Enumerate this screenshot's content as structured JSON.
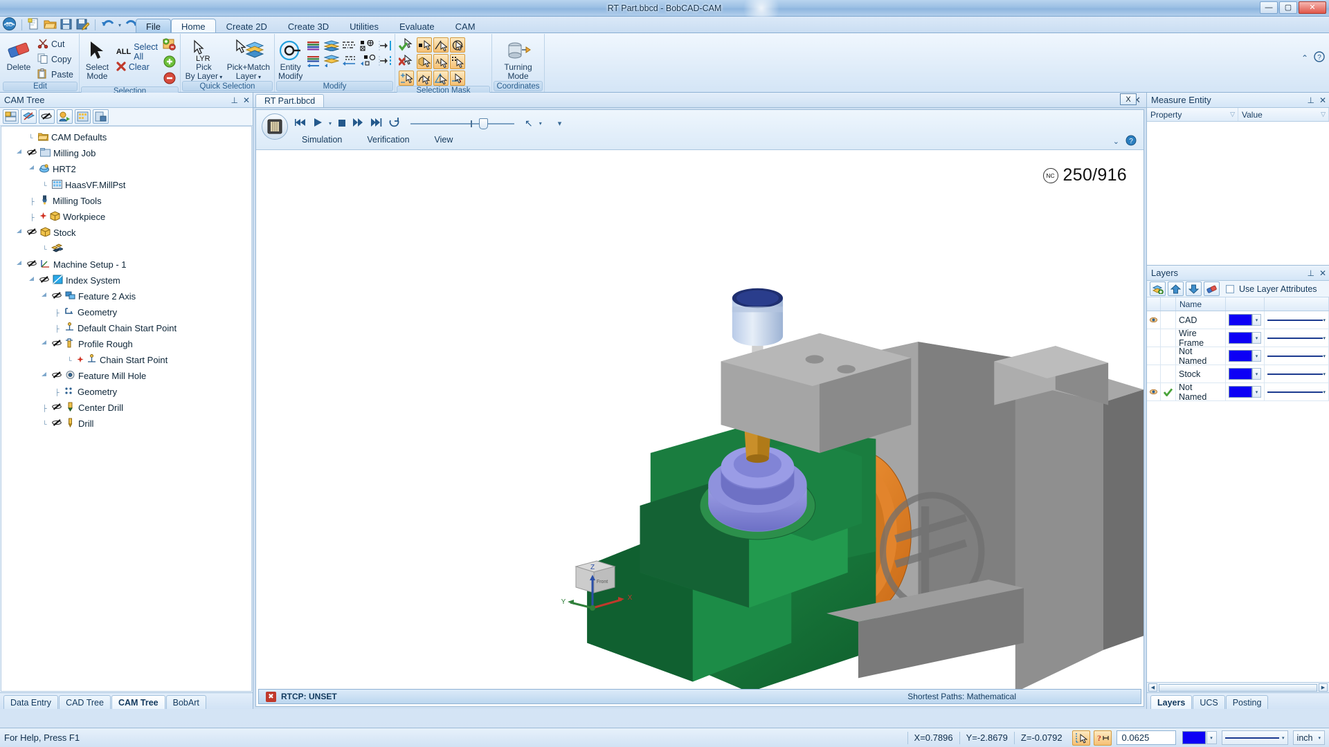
{
  "window": {
    "title": "RT Part.bbcd - BobCAD-CAM",
    "minimize": "—",
    "maximize": "▢",
    "close": "✕"
  },
  "quick_access": {
    "items": [
      {
        "name": "app-orb",
        "glyph": "◕"
      },
      {
        "name": "new-file",
        "glyph": "🗋"
      },
      {
        "name": "open-file",
        "glyph": "🗁"
      },
      {
        "name": "save-file",
        "glyph": "🖫"
      },
      {
        "name": "save-as-file",
        "glyph": "🖫"
      },
      {
        "name": "undo",
        "glyph": "↺"
      },
      {
        "name": "redo",
        "glyph": "↻"
      }
    ]
  },
  "ribbon": {
    "tabs": [
      {
        "label": "File",
        "active": false,
        "file": true
      },
      {
        "label": "Home",
        "active": true
      },
      {
        "label": "Create 2D",
        "active": false
      },
      {
        "label": "Create 3D",
        "active": false
      },
      {
        "label": "Utilities",
        "active": false
      },
      {
        "label": "Evaluate",
        "active": false
      },
      {
        "label": "CAM",
        "active": false
      }
    ],
    "groups": {
      "edit": {
        "title": "Edit",
        "delete_label": "Delete",
        "cut_label": "Cut",
        "copy_label": "Copy",
        "paste_label": "Paste"
      },
      "selection": {
        "title": "Selection",
        "select_mode_line1": "Select",
        "select_mode_line2": "Mode",
        "select_all_label": "Select All",
        "select_all_prefix": "ALL",
        "clear_label": "Clear"
      },
      "quick_selection": {
        "title": "Quick Selection",
        "pick_by_layer_line1": "Pick",
        "pick_by_layer_line2": "By Layer",
        "pick_by_layer_badge": "LYR",
        "pick_match_layer_line1": "Pick+Match",
        "pick_match_layer_line2": "Layer",
        "dropdown_glyph": "▾"
      },
      "modify": {
        "title": "Modify",
        "entity_modify_line1": "Entity",
        "entity_modify_line2": "Modify"
      },
      "selection_mask": {
        "title": "Selection Mask"
      },
      "coordinates": {
        "title": "Coordinates",
        "turning_mode_line1": "Turning",
        "turning_mode_line2": "Mode"
      }
    },
    "help_glyph": "?",
    "collapse_glyph": "⌃"
  },
  "cam_tree_panel": {
    "title": "CAM Tree",
    "pin_glyph": "⊥",
    "close_glyph": "✕",
    "toolbar": [
      {
        "name": "stock-wizard-button",
        "glyph": "▦"
      },
      {
        "name": "toggle-toolpath-button",
        "glyph": "◩"
      },
      {
        "name": "show-hide-button",
        "glyph": "✎"
      },
      {
        "name": "post-process-button",
        "glyph": "●"
      },
      {
        "name": "machine-setup-button",
        "glyph": "▤"
      },
      {
        "name": "save-setup-button",
        "glyph": "▣"
      }
    ],
    "items": [
      {
        "label": "CAM Defaults",
        "depth": 1,
        "expander": "",
        "icon": "📂"
      },
      {
        "label": "Milling Job",
        "depth": 1,
        "expander": "▲",
        "icon": "🗂",
        "toggle": "⊘"
      },
      {
        "label": "HRT2",
        "depth": 2,
        "expander": "▲",
        "icon": "🖨"
      },
      {
        "label": "HaasVF.MillPst",
        "depth": 3,
        "expander": "",
        "icon": "▦"
      },
      {
        "label": "Milling Tools",
        "depth": 2,
        "expander": "",
        "icon": "⊻"
      },
      {
        "label": "Workpiece",
        "depth": 2,
        "expander": "",
        "icon": "📦",
        "toggle": "✦"
      },
      {
        "label": "Stock",
        "depth": 2,
        "expander": "▲",
        "icon": "📦",
        "toggle": "⊘"
      },
      {
        "label": "",
        "depth": 3,
        "expander": "",
        "icon": "▰"
      },
      {
        "label": "Machine Setup - 1",
        "depth": 2,
        "expander": "▲",
        "icon": "⊿",
        "toggle": "⊘"
      },
      {
        "label": "Index System",
        "depth": 3,
        "expander": "▲",
        "icon": "◩",
        "toggle": "⊘"
      },
      {
        "label": "Feature 2 Axis",
        "depth": 4,
        "expander": "▲",
        "icon": "⊔",
        "toggle": "⊘"
      },
      {
        "label": "Geometry",
        "depth": 5,
        "expander": "",
        "icon": "⌐"
      },
      {
        "label": "Default Chain Start Point",
        "depth": 5,
        "expander": "",
        "icon": "⊥"
      },
      {
        "label": "Profile Rough",
        "depth": 5,
        "expander": "▲",
        "icon": "⌷",
        "toggle": "⊘"
      },
      {
        "label": "Chain Start Point",
        "depth": 6,
        "expander": "",
        "icon": "⊥",
        "toggle": "✦"
      },
      {
        "label": "Feature Mill Hole",
        "depth": 4,
        "expander": "▲",
        "icon": "⊙",
        "toggle": "⊘"
      },
      {
        "label": "Geometry",
        "depth": 5,
        "expander": "",
        "icon": "⁙"
      },
      {
        "label": "Center Drill",
        "depth": 5,
        "expander": "",
        "icon": "⌷",
        "toggle": "⊘"
      },
      {
        "label": "Drill",
        "depth": 5,
        "expander": "",
        "icon": "⌷",
        "toggle": "⊘"
      }
    ],
    "bottom_tabs": [
      {
        "label": "Data Entry",
        "active": false
      },
      {
        "label": "CAD Tree",
        "active": false
      },
      {
        "label": "CAM Tree",
        "active": true
      },
      {
        "label": "BobArt",
        "active": false
      }
    ]
  },
  "document": {
    "tab_label": "RT Part.bbcd",
    "close_glyph": "✕"
  },
  "simulation": {
    "close_button": "X",
    "orb_glyph": "▤",
    "controls": [
      {
        "name": "rewind-button",
        "glyph": "⏮"
      },
      {
        "name": "play-button",
        "glyph": "▶"
      },
      {
        "name": "play-dropdown",
        "glyph": "▾"
      },
      {
        "name": "stop-button",
        "glyph": "■"
      },
      {
        "name": "fast-forward-button",
        "glyph": "⏩"
      },
      {
        "name": "skip-end-button",
        "glyph": "⏭"
      },
      {
        "name": "loop-button",
        "glyph": "↻"
      }
    ],
    "pointer_glyph": "↖",
    "pointer_dropdown": "▾",
    "overflow_glyph": "▾",
    "menu": [
      {
        "label": "Simulation"
      },
      {
        "label": "Verification"
      },
      {
        "label": "View"
      }
    ],
    "expand_glyph": "⌄",
    "help_glyph": "?"
  },
  "viewport": {
    "nc_label": "NC",
    "nc_counter": "250/916",
    "axis": {
      "x": "X",
      "y": "Y",
      "z": "Z",
      "cube_label": "Front"
    },
    "status": {
      "rtcp": "RTCP: UNSET",
      "rtcp_icon": "✖",
      "paths": "Shortest Paths: Mathematical"
    }
  },
  "measure_panel": {
    "title": "Measure Entity",
    "pin_glyph": "⊥",
    "close_glyph": "✕",
    "columns": [
      {
        "label": "Property",
        "width": 112
      },
      {
        "label": "Value",
        "width": 150
      }
    ],
    "filter_glyph": "▽",
    "rows": []
  },
  "layers_panel": {
    "title": "Layers",
    "pin_glyph": "⊥",
    "close_glyph": "✕",
    "toolbar": [
      {
        "name": "add-layer-button",
        "glyph": "▤"
      },
      {
        "name": "move-layer-up-button",
        "glyph": "⬆"
      },
      {
        "name": "move-layer-down-button",
        "glyph": "⬇"
      },
      {
        "name": "delete-layer-button",
        "glyph": "⬬"
      }
    ],
    "use_layer_attributes_label": "Use Layer Attributes",
    "use_layer_attributes_checked": false,
    "columns": [
      "",
      "",
      "Name",
      "",
      ""
    ],
    "rows": [
      {
        "visible": true,
        "active": false,
        "name": "CAD",
        "color": "#0d00f5",
        "linetype": "solid"
      },
      {
        "visible": false,
        "active": false,
        "name": "Wire Frame",
        "color": "#0d00f5",
        "linetype": "solid"
      },
      {
        "visible": false,
        "active": false,
        "name": "Not Named",
        "color": "#0d00f5",
        "linetype": "solid"
      },
      {
        "visible": false,
        "active": false,
        "name": "Stock",
        "color": "#0d00f5",
        "linetype": "solid"
      },
      {
        "visible": true,
        "active": true,
        "name": "Not Named",
        "color": "#0d00f5",
        "linetype": "solid"
      }
    ],
    "bottom_tabs": [
      {
        "label": "Layers",
        "active": true
      },
      {
        "label": "UCS",
        "active": false
      },
      {
        "label": "Posting",
        "active": false
      }
    ],
    "scroll_left_glyph": "◀",
    "scroll_right_glyph": "▶"
  },
  "statusbar": {
    "help_text": "For Help, Press F1",
    "x": "X=0.7896",
    "y": "Y=-2.8679",
    "z": "Z=-0.0792",
    "snap_icon": "⌐",
    "dim_icon": "↔",
    "value": "0.0625",
    "color": "#0d00f5",
    "caret": "▾",
    "units": "inch"
  },
  "theme": {
    "accent": "#2a5f90",
    "layer_color": "#0d00f5",
    "stock_green": "#1a7a3c",
    "tool_blue": "#4e55b0",
    "copper": "#d97a28",
    "machine_gray": "#8c8c8c"
  }
}
